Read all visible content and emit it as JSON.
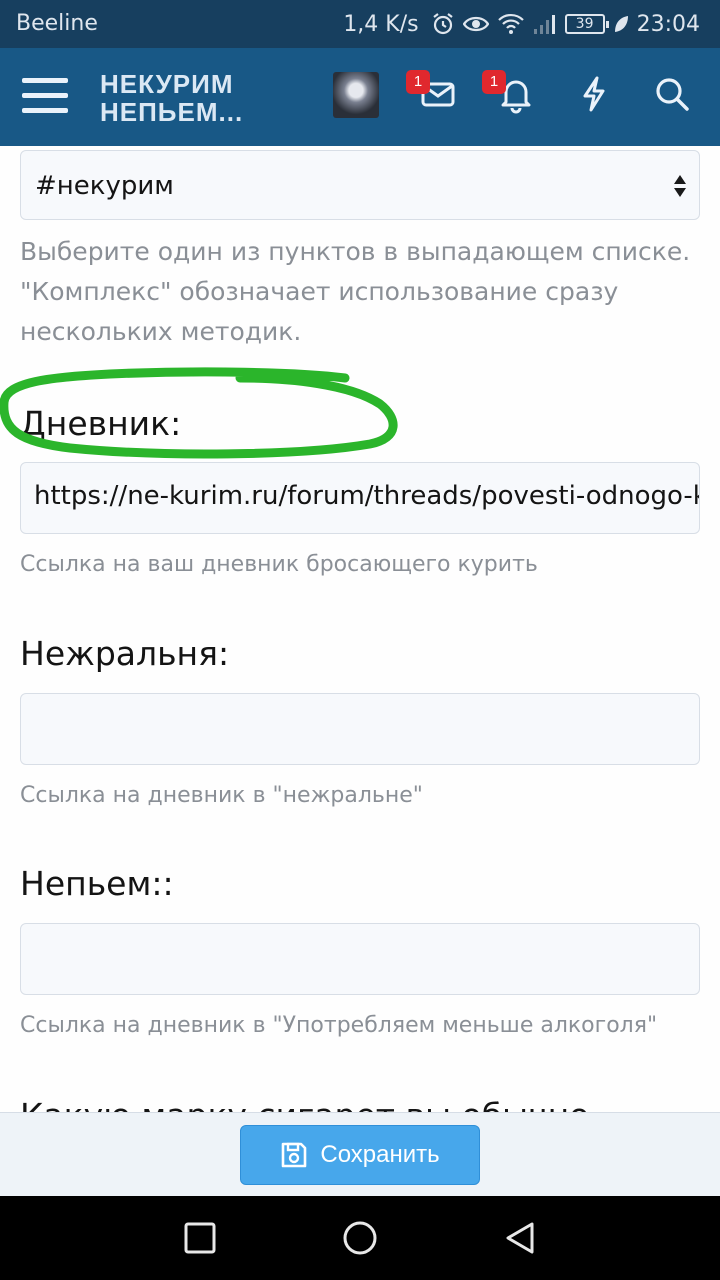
{
  "status_bar": {
    "carrier": "Beeline",
    "speed": "1,4 K/s",
    "battery": "39",
    "time": "23:04",
    "icons": [
      "alarm-icon",
      "eye-icon",
      "wifi-icon",
      "signal-icon",
      "battery-icon",
      "leaf-icon"
    ]
  },
  "header": {
    "logo_line1": "НЕКУРИМ",
    "logo_line2": "НЕПЬЕМ...",
    "messages_badge": "1",
    "alerts_badge": "1",
    "icons": [
      "menu-icon",
      "avatar",
      "mail-icon",
      "bell-icon",
      "lightning-icon",
      "search-icon"
    ]
  },
  "form": {
    "method_select_value": "#некурим",
    "method_hint": "Выберите один из пунктов в выпадающем списке. \"Комплекс\" обозначает использование сразу нескольких методик.",
    "diary_label": "Дневник:",
    "diary_value": "https://ne-kurim.ru/forum/threads/povesti-odnogo-kurilshchika",
    "diary_hint": "Ссылка на ваш дневник бросающего курить",
    "nezhralnya_label": "Нежральня:",
    "nezhralnya_value": "",
    "nezhralnya_hint": "Ссылка на дневник в \"нежральне\"",
    "nepyem_label": "Непьем::",
    "nepyem_value": "",
    "nepyem_hint": "Ссылка на дневник в \"Употребляем меньше алкоголя\"",
    "next_label_cut": "Какую марку сигарет вы обычно"
  },
  "save_button": {
    "label": "Сохранить"
  },
  "colors": {
    "status_bar": "#173f5f",
    "header": "#185886",
    "save_button": "#47a7eb",
    "badge": "#e0282e",
    "annotation_circle": "#2bb52b"
  },
  "nav_icons": [
    "recent-apps-icon",
    "home-icon",
    "back-icon"
  ]
}
